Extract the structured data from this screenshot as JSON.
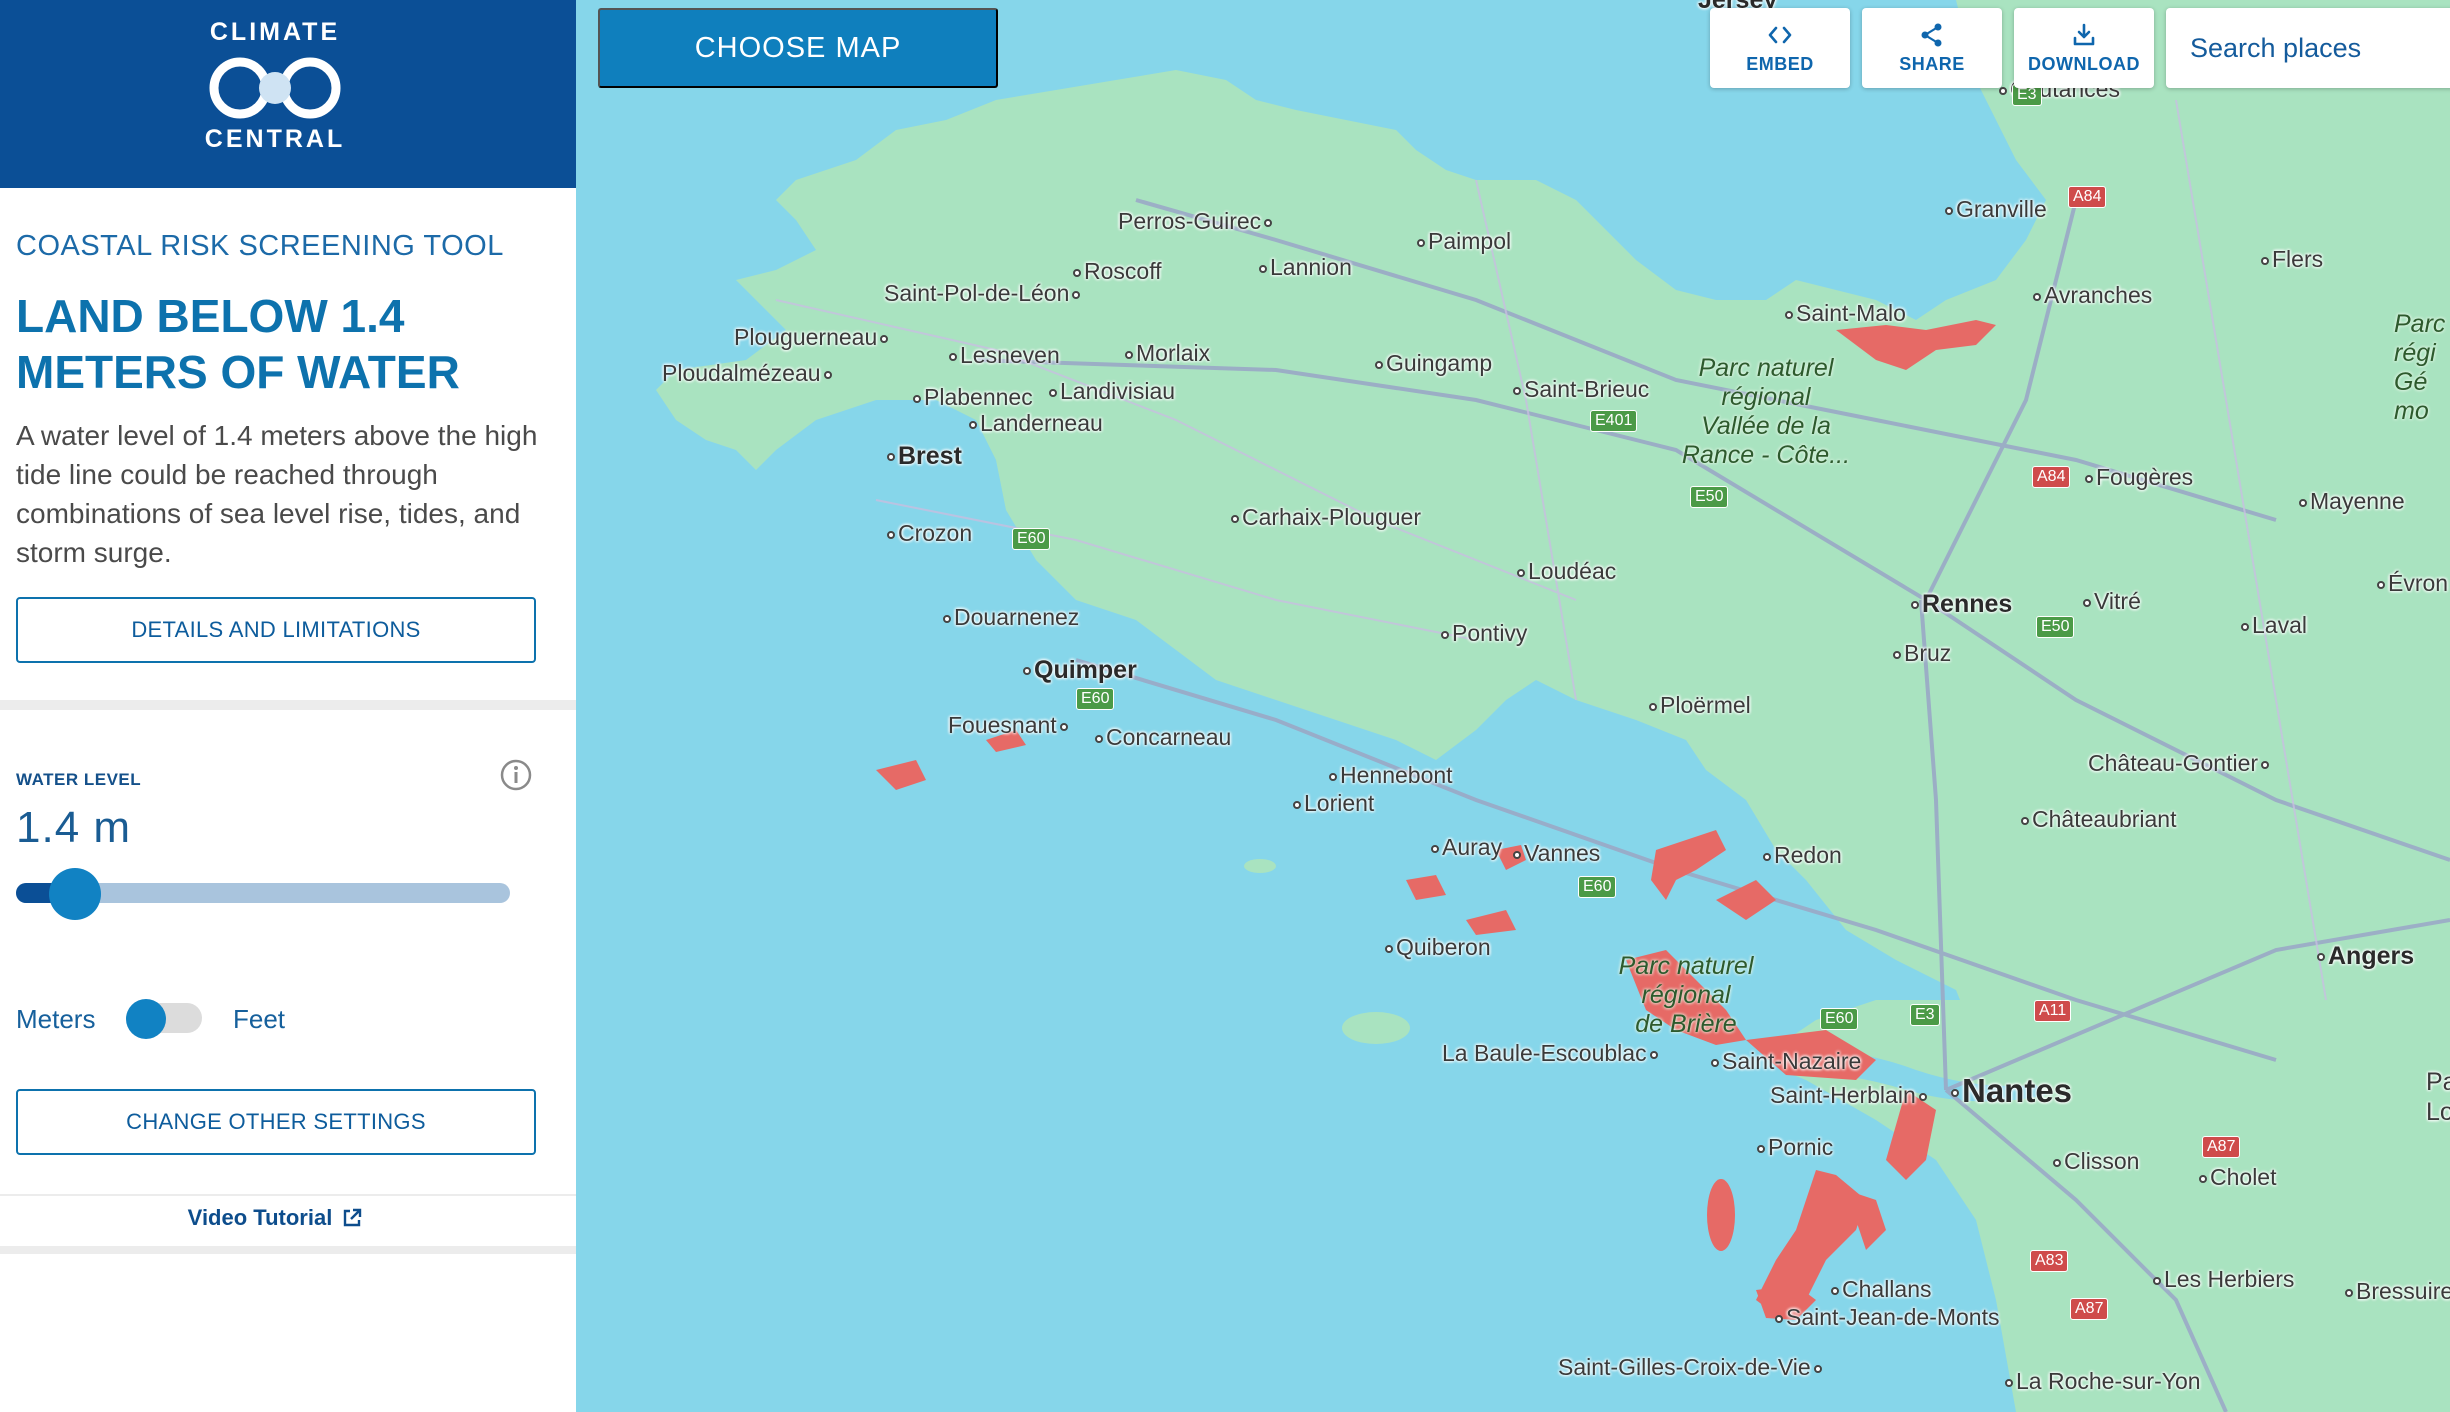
{
  "brand": {
    "line1": "CLIMATE",
    "line2": "CENTRAL",
    "colors": {
      "header_bg": "#0b4f96",
      "accent": "#0d72ad",
      "flood": "#e66a66"
    }
  },
  "sidebar": {
    "tool_label": "COASTAL RISK SCREENING TOOL",
    "title": "LAND BELOW 1.4 METERS OF WATER",
    "description": "A water level of 1.4 meters above the high tide line could be reached through combinations of sea level rise, tides, and storm surge.",
    "details_button": "DETAILS AND LIMITATIONS",
    "water_level": {
      "label": "WATER LEVEL",
      "value_text": "1.4 m",
      "slider_fraction": 0.12
    },
    "units": {
      "left": "Meters",
      "right": "Feet",
      "selected": "Meters"
    },
    "settings_button": "CHANGE OTHER SETTINGS",
    "video_link": "Video Tutorial",
    "icons": {
      "info": "info-icon",
      "external": "external-link-icon"
    }
  },
  "toolbar": {
    "choose_map": "CHOOSE MAP",
    "embed": "EMBED",
    "share": "SHARE",
    "download": "DOWNLOAD",
    "search_placeholder": "Search places"
  },
  "map": {
    "places": {
      "jersey": "Jersey",
      "coutances": "Coutances",
      "granville": "Granville",
      "flers": "Flers",
      "avranches": "Avranches",
      "saint_malo": "Saint-Malo",
      "perros": "Perros-Guirec",
      "paimpol": "Paimpol",
      "lannion": "Lannion",
      "roscoff": "Roscoff",
      "st_pol": "Saint-Pol-de-Léon",
      "plouguerneau": "Plouguerneau",
      "ploudalmezeau": "Ploudalmézeau",
      "lesneven": "Lesneven",
      "morlaix": "Morlaix",
      "guingamp": "Guingamp",
      "saint_brieuc": "Saint-Brieuc",
      "plabennec": "Plabennec",
      "landivisiau": "Landivisiau",
      "landerneau": "Landerneau",
      "brest": "Brest",
      "fougeres": "Fougères",
      "mayenne": "Mayenne",
      "carhaix": "Carhaix-Plouguer",
      "crozon": "Crozon",
      "loudeac": "Loudéac",
      "rennes": "Rennes",
      "vitre": "Vitré",
      "evron": "Évron",
      "douarnenez": "Douarnenez",
      "pontivy": "Pontivy",
      "laval": "Laval",
      "bruz": "Bruz",
      "quimper": "Quimper",
      "ploermel": "Ploërmel",
      "fouesnant": "Fouesnant",
      "concarneau": "Concarneau",
      "chateau_gontier": "Château-Gontier",
      "hennebont": "Hennebont",
      "lorient": "Lorient",
      "chateaubriant": "Châteaubriant",
      "auray": "Auray",
      "vannes": "Vannes",
      "redon": "Redon",
      "quiberon": "Quiberon",
      "angers": "Angers",
      "la_baule": "La Baule-Escoublac",
      "saint_nazaire": "Saint-Nazaire",
      "saint_herblain": "Saint-Herblain",
      "nantes": "Nantes",
      "pornic": "Pornic",
      "clisson": "Clisson",
      "cholet": "Cholet",
      "challans": "Challans",
      "les_herbiers": "Les Herbiers",
      "bressuire": "Bressuire",
      "st_jean": "Saint-Jean-de-Monts",
      "st_gilles": "Saint-Gilles-Croix-de-Vie",
      "la_roche": "La Roche-sur-Yon"
    },
    "parks": {
      "rance_1": "Parc naturel",
      "rance_2": "régional",
      "rance_3": "Vallée de la",
      "rance_4": "Rance - Côte...",
      "briere_1": "Parc naturel",
      "briere_2": "régional",
      "briere_3": "de Brière",
      "edge_1": "Parc",
      "edge_2": "régi",
      "edge_3": "Gé",
      "edge_4": "mo"
    },
    "roads": {
      "e3a": "E3",
      "a84a": "A84",
      "e401": "E401",
      "a84b": "A84",
      "e50a": "E50",
      "e60a": "E60",
      "e50b": "E50",
      "e60b": "E60",
      "e60c": "E60",
      "e60d": "E60",
      "e3b": "E3",
      "a11": "A11",
      "a87a": "A87",
      "a83": "A83",
      "a87b": "A87"
    },
    "edge_labels": {
      "pa": "Pa",
      "lo": "Lo"
    }
  }
}
